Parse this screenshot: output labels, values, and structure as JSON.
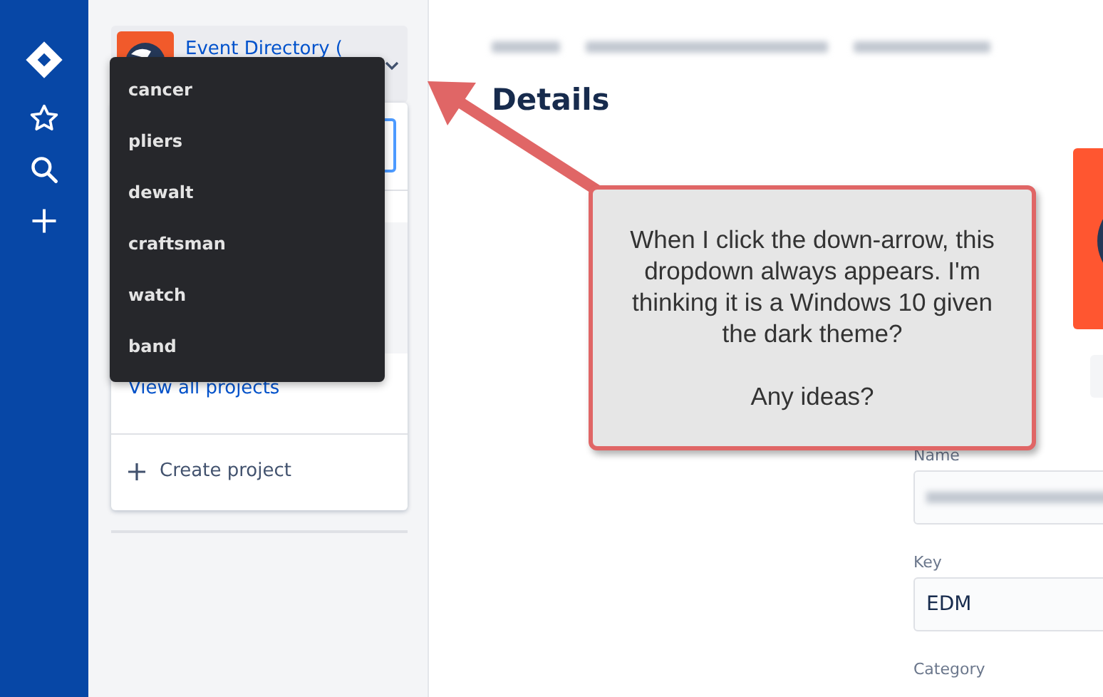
{
  "project_switcher": {
    "title": "Event Directory (",
    "menu_items": [
      "cancer",
      "pliers",
      "dewalt",
      "craftsman",
      "watch",
      "band"
    ],
    "view_all": "View all projects",
    "create": "Create project"
  },
  "page": {
    "heading": "Details",
    "fields": [
      {
        "label": "Name",
        "kind": "blurred"
      },
      {
        "label": "Key",
        "kind": "text",
        "value": "EDM"
      },
      {
        "label": "Category",
        "kind": "label"
      }
    ]
  },
  "annotation": {
    "lines": [
      "When I click the down-arrow, this dropdown always appears. I'm thinking it is a Windows 10 given the dark theme?",
      "Any ideas?"
    ]
  }
}
